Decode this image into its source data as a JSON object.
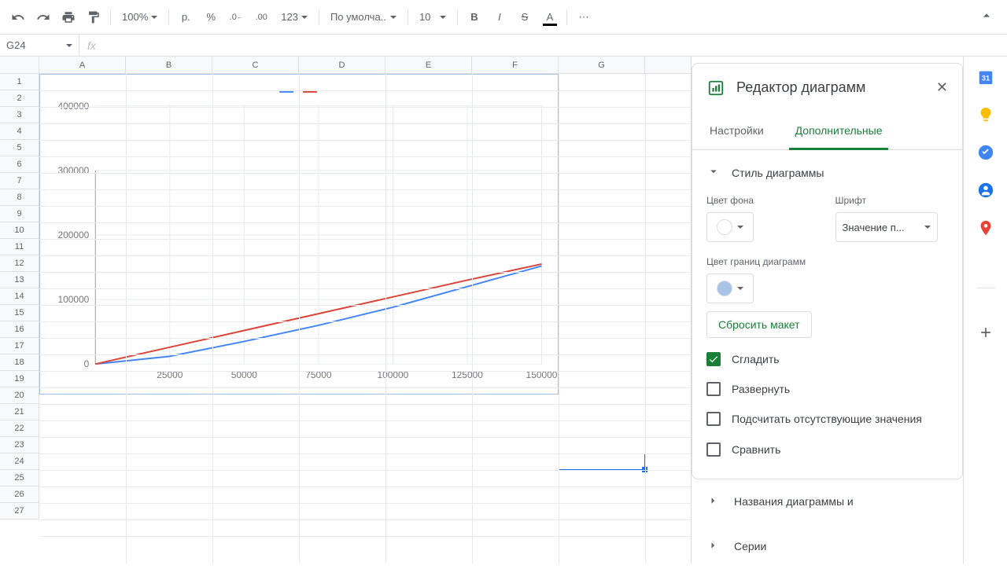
{
  "toolbar": {
    "zoom": "100%",
    "currency": "р.",
    "percent": "%",
    "dec_minus": ".0",
    "dec_plus": ".00",
    "format_123": "123",
    "font": "По умолча...",
    "font_size": "10"
  },
  "namebox": "G24",
  "columns": [
    "A",
    "B",
    "C",
    "D",
    "E",
    "F",
    "G"
  ],
  "rows": [
    1,
    2,
    3,
    4,
    5,
    6,
    7,
    8,
    9,
    10,
    11,
    12,
    13,
    14,
    15,
    16,
    17,
    18,
    19,
    20,
    21,
    22,
    23,
    24,
    25,
    26,
    27
  ],
  "sidebar": {
    "title": "Редактор диаграмм",
    "tabs": {
      "settings": "Настройки",
      "customize": "Дополнительные"
    },
    "style_section": "Стиль диаграммы",
    "bg_color_label": "Цвет фона",
    "font_label": "Шрифт",
    "font_value": "Значение п...",
    "border_color_label": "Цвет границ диаграмм",
    "reset_layout": "Сбросить макет",
    "cb_smooth": "Сгладить",
    "cb_maximize": "Развернуть",
    "cb_plot_null": "Подсчитать отсутствующие значения",
    "cb_compare": "Сравнить",
    "titles_section": "Названия диаграммы и",
    "series_section": "Серии"
  },
  "chart_data": {
    "type": "line",
    "x": [
      0,
      25000,
      50000,
      75000,
      100000,
      125000,
      150000
    ],
    "series": [
      {
        "name": "",
        "color": "#4285f4",
        "values": [
          0,
          12000,
          35000,
          60000,
          88000,
          120000,
          152000
        ]
      },
      {
        "name": "",
        "color": "#db4437",
        "values": [
          0,
          26000,
          52000,
          78000,
          104000,
          130000,
          155000
        ]
      }
    ],
    "xlim": [
      0,
      150000
    ],
    "ylim": [
      0,
      400000
    ],
    "xticks": [
      25000,
      50000,
      75000,
      100000,
      125000,
      150000
    ],
    "yticks": [
      0,
      100000,
      200000,
      300000,
      400000
    ]
  }
}
